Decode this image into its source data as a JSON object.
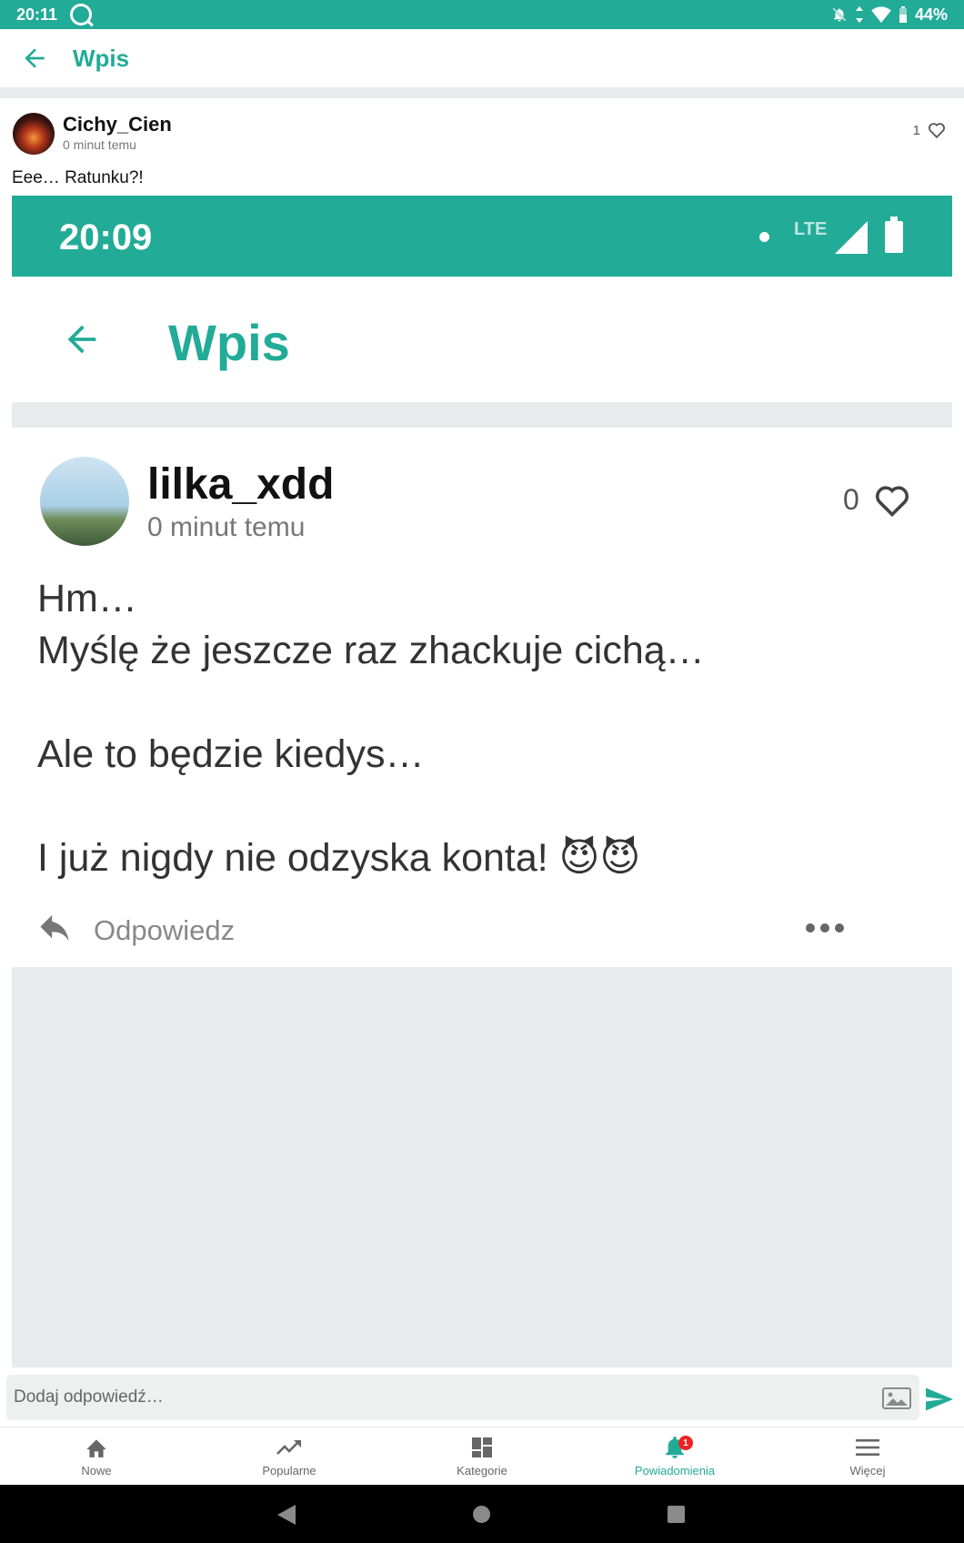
{
  "status_bar": {
    "time": "20:11",
    "battery": "44%"
  },
  "app_bar": {
    "title": "Wpis"
  },
  "post": {
    "username": "Cichy_Cien",
    "time": "0 minut temu",
    "like_count": "1",
    "text": "Eee… Ratunku?!"
  },
  "embedded_screenshot": {
    "status_time": "20:09",
    "network": "LTE",
    "title": "Wpis",
    "username": "lilka_xdd",
    "time": "0 minut temu",
    "like_count": "0",
    "body_lines": [
      "Hm…",
      "Myślę że jeszcze raz zhackuje cichą…",
      "",
      "Ale to będzie kiedys…",
      "",
      "I już nigdy nie odzyska konta! 😈😈"
    ],
    "reply_label": "Odpowiedz"
  },
  "composer": {
    "placeholder": "Dodaj odpowiedź…"
  },
  "bottom_nav": {
    "items": [
      {
        "label": "Nowe",
        "icon": "home-icon"
      },
      {
        "label": "Popularne",
        "icon": "trending-icon"
      },
      {
        "label": "Kategorie",
        "icon": "dashboard-icon"
      },
      {
        "label": "Powiadomienia",
        "icon": "bell-icon",
        "badge": "1",
        "active": true
      },
      {
        "label": "Więcej",
        "icon": "menu-icon"
      }
    ]
  },
  "colors": {
    "accent": "#22ab97",
    "divider": "#e8ebec",
    "badge": "#e22222"
  }
}
